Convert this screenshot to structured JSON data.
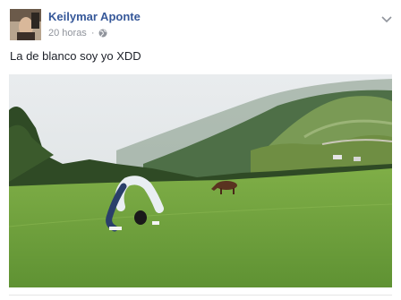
{
  "post": {
    "author_name": "Keilymar Aponte",
    "timestamp": "20 horas",
    "separator": "·",
    "privacy_icon": "globe-icon",
    "menu_icon": "chevron-down-icon",
    "caption": "La de blanco soy yo XDD",
    "link_color": "#365899",
    "meta_color": "#90949c"
  }
}
